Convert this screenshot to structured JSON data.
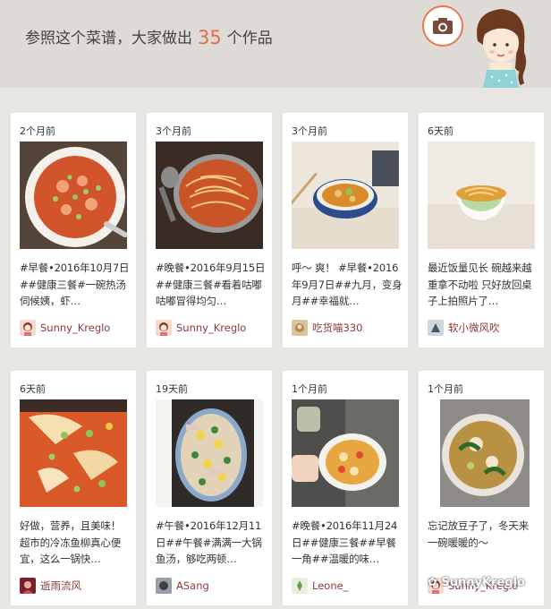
{
  "header": {
    "title_prefix": "参照这个菜谱，大家做出",
    "count": "35",
    "title_suffix": "个作品"
  },
  "works": [
    {
      "time": "2个月前",
      "desc": "#早餐•2016年10月7日##健康三餐#一碗热汤伺候姨，虾…",
      "author": "Sunny_Kreglo"
    },
    {
      "time": "3个月前",
      "desc": "#晚餐•2016年9月15日##健康三餐#看着咕嘟咕嘟冒得均匀…",
      "author": "Sunny_Kreglo"
    },
    {
      "time": "3个月前",
      "desc": "呼～ 爽！ #早餐•2016年9月7日##九月，变身月##幸福就…",
      "author": "吃货喵330"
    },
    {
      "time": "6天前",
      "desc": "最近饭量见长 碗越来越重拿不动啦 只好放回桌子上拍照片了…",
      "author": "软小微风吹"
    },
    {
      "time": "6天前",
      "desc": "好做，营养，且美味！超市的冷冻鱼柳真心便宜，这么一锅快…",
      "author": "逝雨流风"
    },
    {
      "time": "19天前",
      "desc": "#午餐•2016年12月11日##午餐#满满一大锅鱼汤，够吃两顿…",
      "author": "ASang"
    },
    {
      "time": "1个月前",
      "desc": "#晚餐•2016年11月24日##健康三餐##早餐一角##温暖的味…",
      "author": "Leone_"
    },
    {
      "time": "1个月前",
      "desc": "忘记放豆子了，冬天来一碗暖暖的～",
      "author": "Sunny_Kreglo"
    }
  ],
  "watermark": "SunnyKreglo",
  "icons": {
    "header_camera": "camera-icon",
    "header_mascot": "girl-mascot-icon"
  },
  "colors": {
    "accent": "#e66a4b",
    "author": "#8b3a3a",
    "background": "#e8e6e3"
  }
}
